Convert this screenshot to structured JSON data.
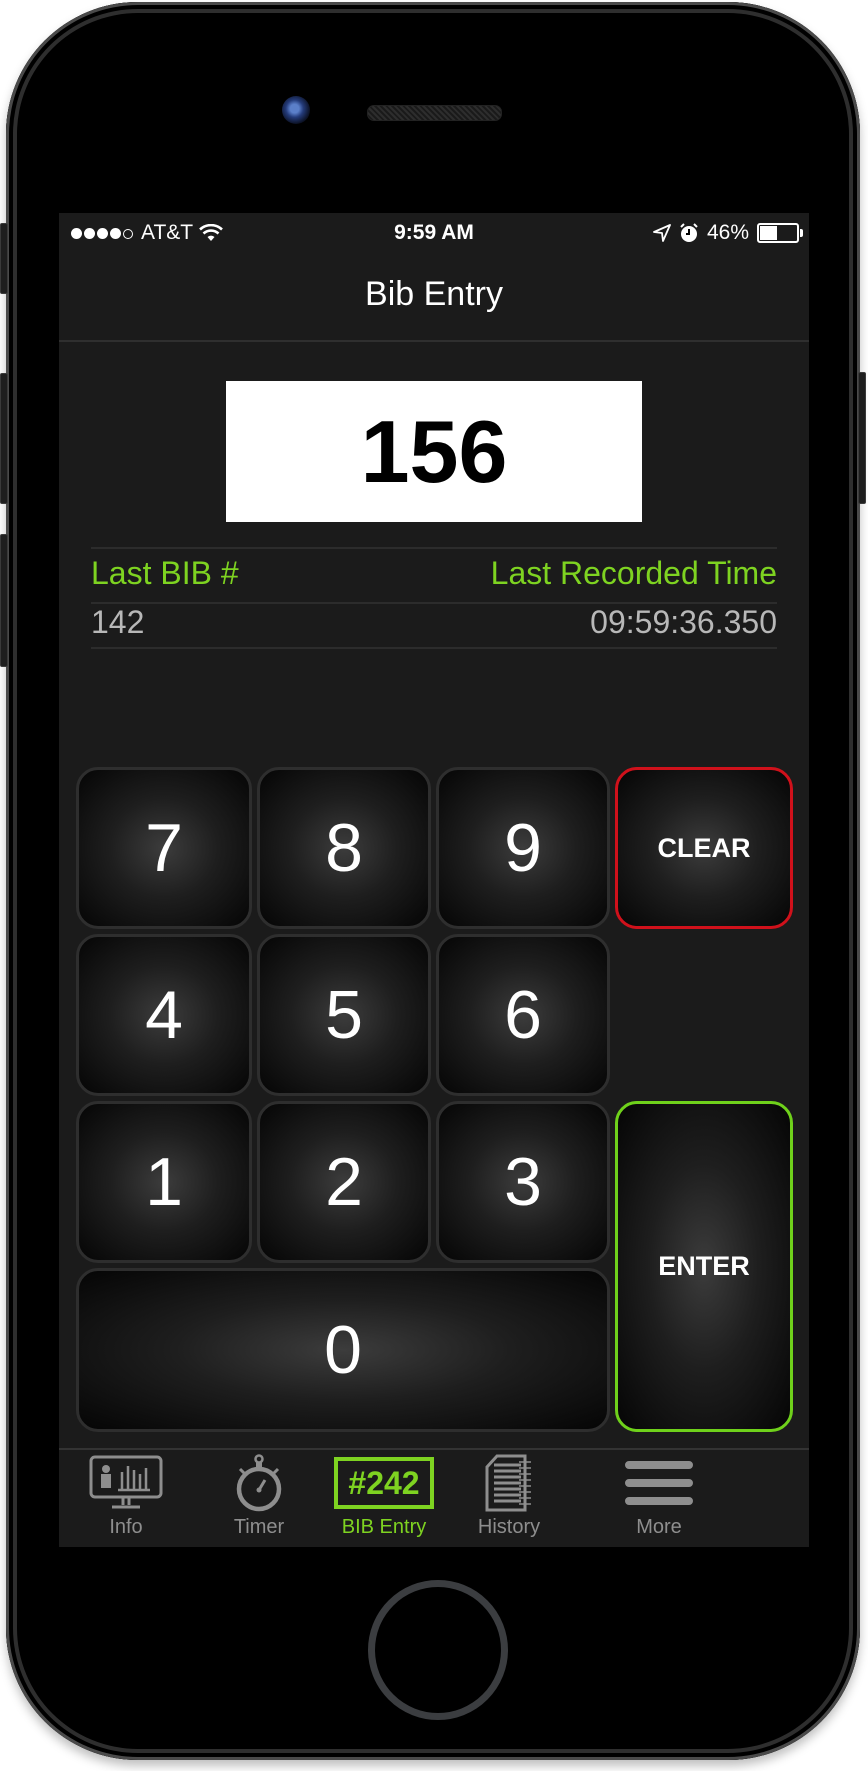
{
  "status_bar": {
    "signal_filled": 4,
    "signal_total": 5,
    "carrier": "AT&T",
    "time": "9:59 AM",
    "battery_percent": "46%",
    "battery_level": 0.46
  },
  "nav": {
    "title": "Bib Entry"
  },
  "bib_entry": {
    "current_value": "156"
  },
  "last_info": {
    "last_bib_label": "Last BIB #",
    "last_time_label": "Last Recorded Time",
    "last_bib_value": "142",
    "last_time_value": "09:59:36.350"
  },
  "keypad": {
    "keys": [
      "7",
      "8",
      "9",
      "4",
      "5",
      "6",
      "1",
      "2",
      "3",
      "0"
    ],
    "clear_label": "CLEAR",
    "enter_label": "ENTER"
  },
  "tabs": [
    {
      "label": "Info",
      "icon": "monitor-chart-icon"
    },
    {
      "label": "Timer",
      "icon": "stopwatch-icon"
    },
    {
      "label": "BIB Entry",
      "icon": "bib-badge-icon",
      "badge": "#242",
      "active": true
    },
    {
      "label": "History",
      "icon": "notebook-icon"
    },
    {
      "label": "More",
      "icon": "hamburger-menu-icon"
    }
  ],
  "colors": {
    "accent_green": "#7ed321",
    "clear_red": "#d0111b",
    "background": "#1b1b1b"
  }
}
